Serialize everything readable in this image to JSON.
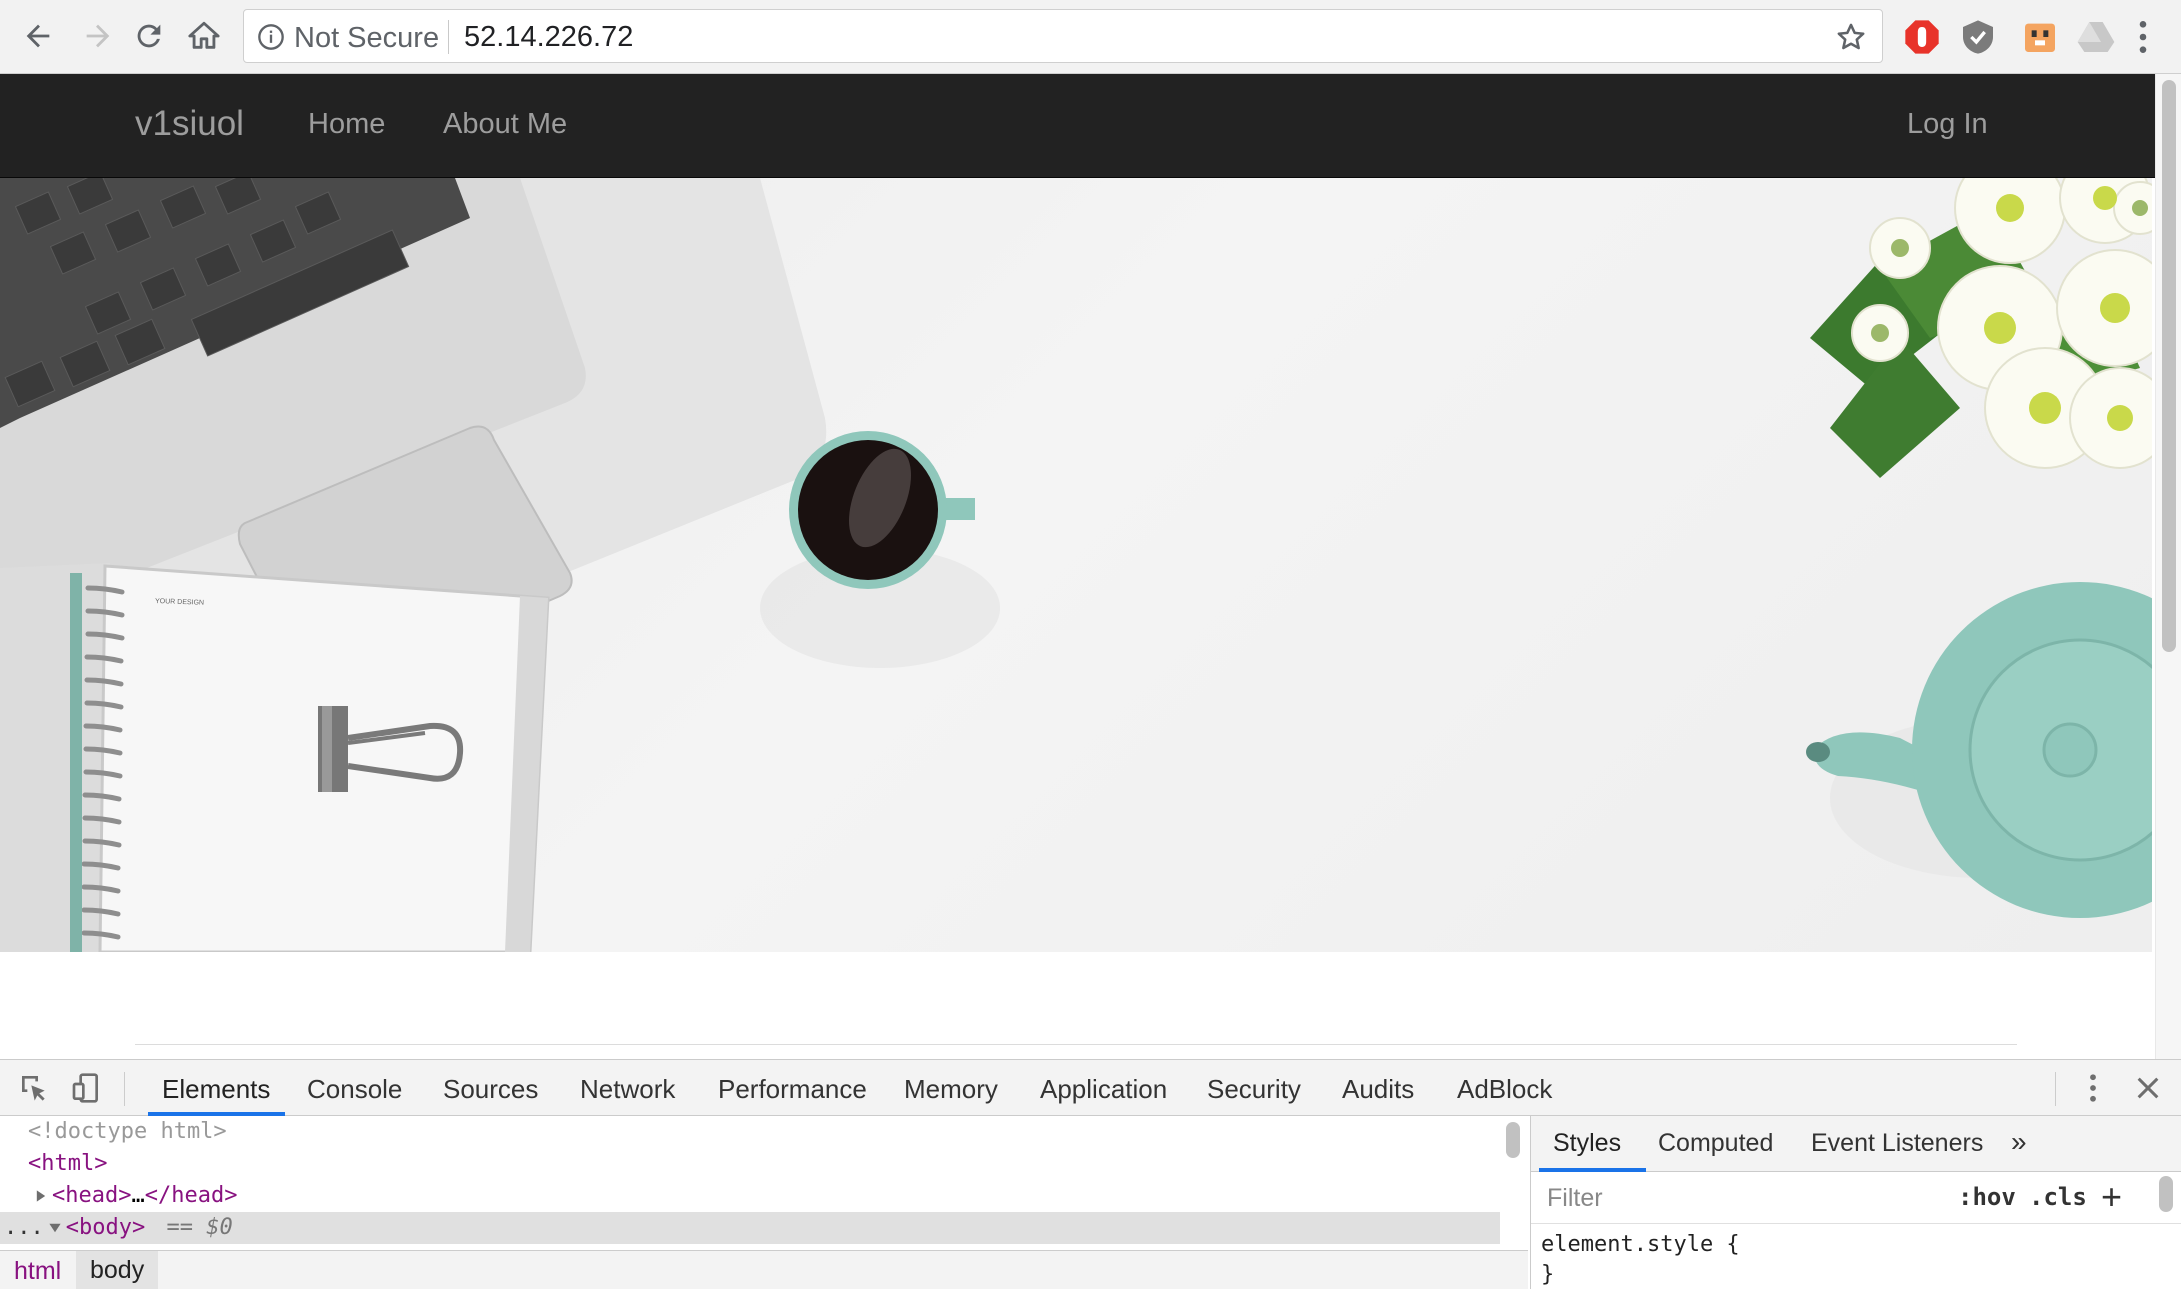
{
  "browser": {
    "security_label": "Not Secure",
    "url": "52.14.226.72"
  },
  "site": {
    "brand": "v1siuol",
    "nav": [
      "Home",
      "About Me"
    ],
    "login": "Log In"
  },
  "devtools": {
    "tabs": [
      "Elements",
      "Console",
      "Sources",
      "Network",
      "Performance",
      "Memory",
      "Application",
      "Security",
      "Audits",
      "AdBlock"
    ],
    "active_tab": "Elements",
    "dom": {
      "doctype": "<!doctype html>",
      "html_open": "<html>",
      "head_open": "<head>",
      "head_ellipsis": "…",
      "head_close": "</head>",
      "body_prefix": "...",
      "body_open": "<body>",
      "body_selected_marker": "== $0"
    },
    "breadcrumbs": [
      "html",
      "body"
    ],
    "styles": {
      "tabs": [
        "Styles",
        "Computed",
        "Event Listeners"
      ],
      "more": "»",
      "filter_placeholder": "Filter",
      "hov": ":hov",
      "cls": ".cls",
      "plus": "+",
      "rule_selector": "element.style {",
      "rule_close": "}"
    }
  },
  "colors": {
    "navbar_bg": "#222222",
    "navbar_text": "#9d9d9d",
    "devtools_accent": "#1a73e8",
    "tag_color": "#881280",
    "teal_ceramic": "#8fc7bb"
  }
}
